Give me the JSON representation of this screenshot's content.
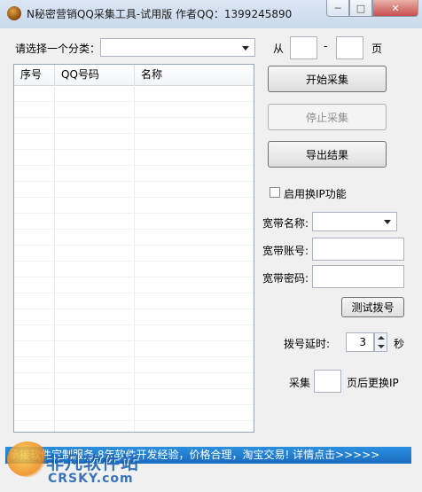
{
  "window": {
    "title": "N秘密营销QQ采集工具-试用版 作者QQ：1399245890",
    "min_glyph": "─",
    "max_glyph": "□",
    "close_glyph": "✕"
  },
  "category": {
    "label": "请选择一个分类：",
    "selected": ""
  },
  "page_range": {
    "from_label": "从",
    "from_value": "",
    "dash": "-",
    "to_value": "",
    "page_label": "页"
  },
  "table": {
    "columns": [
      "序号",
      "QQ号码",
      "名称"
    ],
    "rows": []
  },
  "buttons": {
    "start": "开始采集",
    "stop": "停止采集",
    "export": "导出结果",
    "test_dial": "测试拨号"
  },
  "ip_switch": {
    "label": "启用换IP功能",
    "checked": false
  },
  "broadband": {
    "name_label": "宽带名称:",
    "name_value": "",
    "account_label": "宽带账号:",
    "account_value": "",
    "password_label": "宽带密码:",
    "password_value": ""
  },
  "dial_delay": {
    "label": "拨号延时:",
    "value": "3",
    "unit": "秒"
  },
  "change_ip": {
    "prefix": "采集",
    "value": "",
    "suffix": "页后更换IP"
  },
  "banner": {
    "text": "承接软件定制服务,8年软件开发经验，价格合理，淘宝交易! 详情点击>>>>>"
  },
  "watermark": {
    "cn": "非凡软件站",
    "en": "CRSKY.com"
  }
}
